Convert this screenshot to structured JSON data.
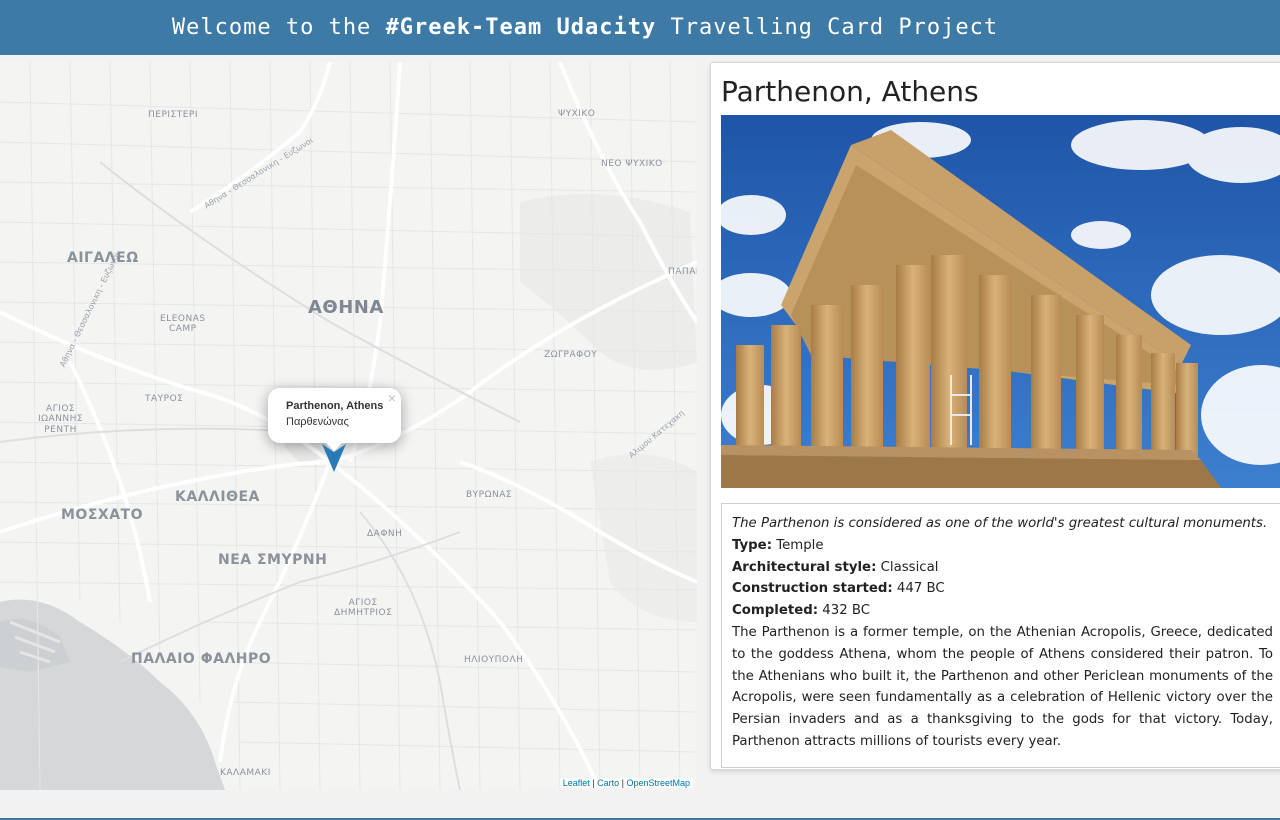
{
  "header": {
    "prefix": "Welcome to the ",
    "brand": "#Greek-Team Udacity",
    "suffix": " Travelling Card Project"
  },
  "map": {
    "places": {
      "peristeri": "ΠΕΡΙΣΤΕΡΙ",
      "psychiko": "ΨΥΧΙΚΟ",
      "neo_psychiko": "ΝΕΟ ΨΥΧΙΚΟ",
      "aigaleo": "ΑΙΓΑΛΕΩ",
      "eleonas_1": "ELEONAS",
      "eleonas_2": "CAMP",
      "athina": "ΑΘΗΝΑ",
      "papagou": "ΠΑΠΑΓ",
      "zografou": "ΖΩΓΡΑΦΟΥ",
      "tavros": "ΤΑΥΡΟΣ",
      "agios_ioannis_1": "ΑΓΙΟΣ",
      "agios_ioannis_2": "ΙΩΑΝΝΗΣ",
      "agios_ioannis_3": "ΡΕΝΤΗ",
      "kallithea": "ΚΑΛΛΙΘΕΑ",
      "vyronas": "ΒΥΡΩΝΑΣ",
      "moschato": "ΜΟΣΧΑΤΟ",
      "dafni": "ΔΑΦΝΗ",
      "nea_smyrni": "ΝΕΑ ΣΜΥΡΝΗ",
      "agios_dimitrios_1": "ΑΓΙΟΣ",
      "agios_dimitrios_2": "ΔΗΜΗΤΡΙΟΣ",
      "palaio_faliro": "ΠΑΛΑΙΟ ΦΑΛΗΡΟ",
      "ilioupoli": "ΗΛΙΟΥΠΟΛΗ",
      "kalamaki": "ΚΑΛΑΜΑΚΙ"
    },
    "roads": {
      "road1": "Αθηνα - Θεσσαλονικη - Ευζωνοι",
      "road2": "Αθηνα - Θεσσαλονικη - Ευζωνοι",
      "road3": "Αλιμου Κατεχακη"
    },
    "popup": {
      "title": "Parthenon, Athens",
      "subtitle": "Παρθενώνας",
      "close": "×"
    },
    "attribution": {
      "leaflet": "Leaflet",
      "sep1": " | ",
      "carto": "Carto",
      "sep2": " | ",
      "osm": "OpenStreetMap"
    },
    "marker_color": "#2a7ab8"
  },
  "card": {
    "title": "Parthenon, Athens",
    "intro": "The Parthenon is considered as one of the world's greatest cultural monuments.",
    "facts": [
      {
        "label": "Type:",
        "value": " Temple"
      },
      {
        "label": "Architectural style:",
        "value": " Classical"
      },
      {
        "label": "Construction started:",
        "value": " 447 BC"
      },
      {
        "label": "Completed:",
        "value": " 432 BC"
      }
    ],
    "body": "The Parthenon is a former temple, on the Athenian Acropolis, Greece, dedicated to the goddess Athena, whom the people of Athens considered their patron. To the Athenians who built it, the Parthenon and other Periclean monuments of the Acropolis, were seen fundamentally as a celebration of Hellenic victory over the Persian invaders and as a thanksgiving to the gods for that victory. Today, Parthenon attracts millions of tourists every year."
  },
  "colors": {
    "header_bg": "#3d7aa6",
    "sky": "#2b62b8",
    "marble": "#c9a164",
    "sea": "#d4d6d8"
  }
}
